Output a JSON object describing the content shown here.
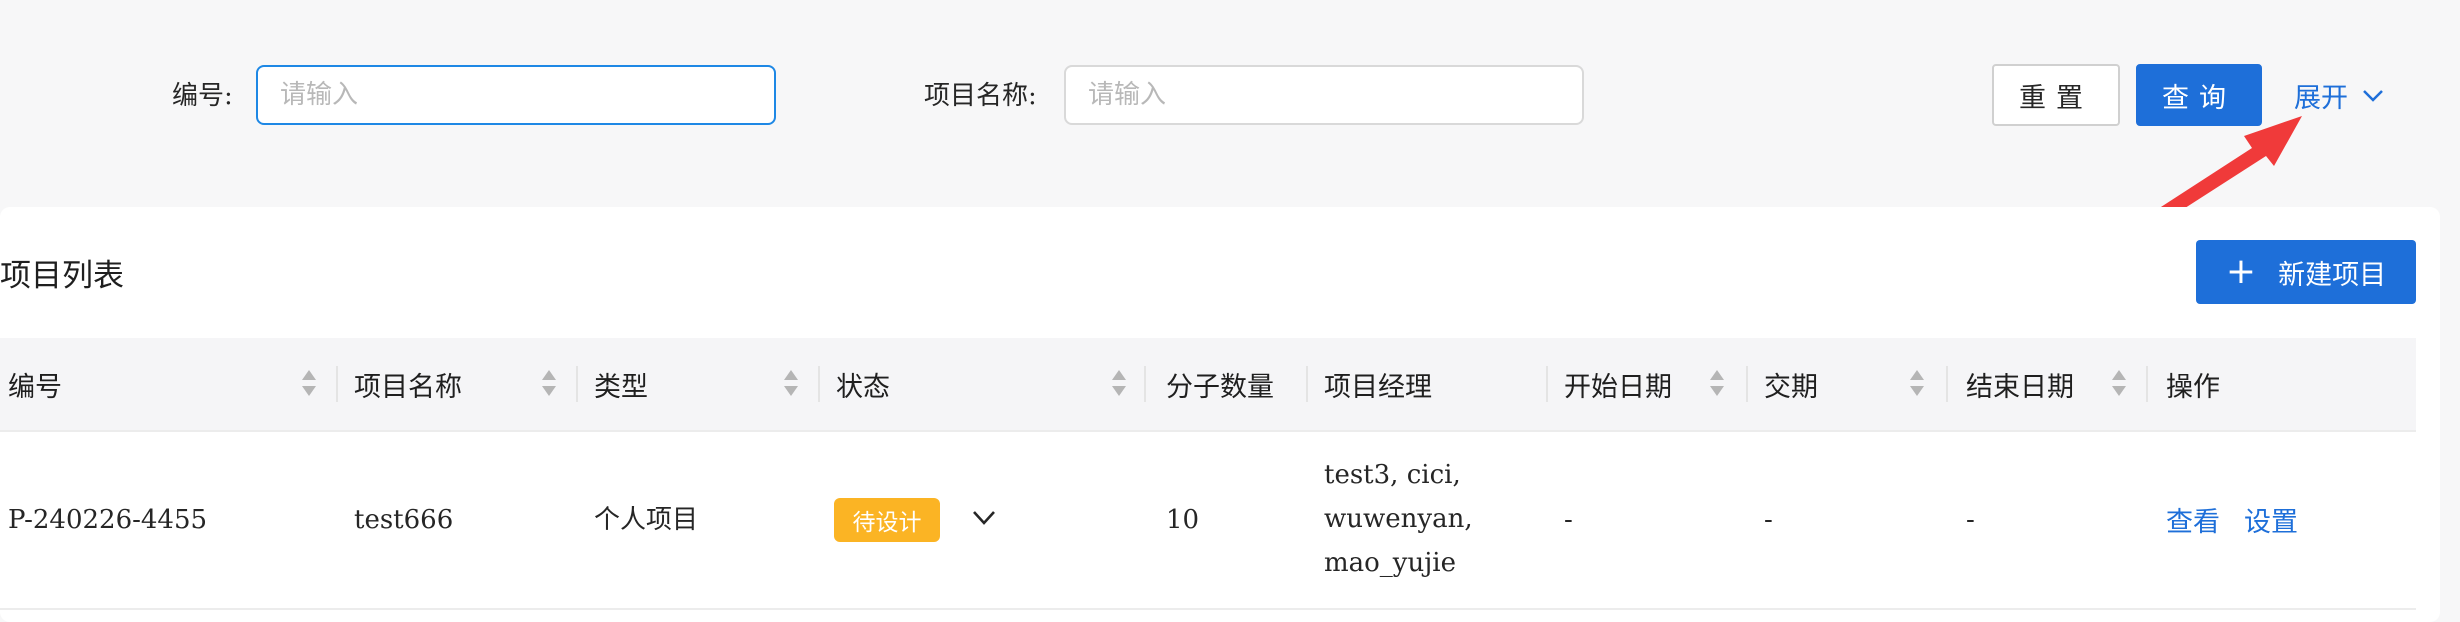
{
  "filters": {
    "code_label": "编号:",
    "code_placeholder": "请输入",
    "name_label": "项目名称:",
    "name_placeholder": "请输入",
    "reset_label": "重置",
    "query_label": "查询",
    "expand_label": "展开"
  },
  "panel": {
    "title": "项目列表",
    "new_button_label": "新建项目"
  },
  "table": {
    "columns": [
      "编号",
      "项目名称",
      "类型",
      "状态",
      "分子数量",
      "项目经理",
      "开始日期",
      "交期",
      "结束日期",
      "操作"
    ],
    "rows": [
      {
        "code": "P-240226-4455",
        "name": "test666",
        "type": "个人项目",
        "status": "待设计",
        "molecule_count": "10",
        "managers": [
          "test3, cici,",
          "wuwenyan,",
          "mao_yujie"
        ],
        "start_date": "-",
        "delivery": "-",
        "end_date": "-",
        "actions": [
          "查看",
          "设置"
        ]
      }
    ]
  },
  "colors": {
    "accent": "#1e6fd9",
    "status_pending": "#fbb424",
    "annotation_arrow": "#f03a3a"
  }
}
